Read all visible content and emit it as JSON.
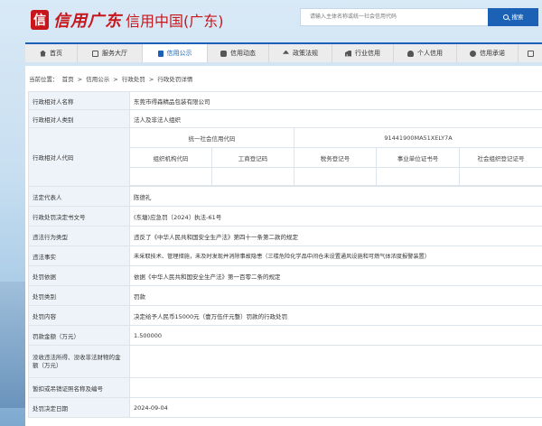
{
  "header": {
    "logo_char": "信",
    "logo_calligraphy": "信用广东",
    "logo_text": "信用中国(广东)",
    "search_placeholder": "请输入主体名称或统一社会信用代码",
    "search_button": "搜索"
  },
  "nav": [
    {
      "label": "首页",
      "icon": "house-icon",
      "active": false
    },
    {
      "label": "服务大厅",
      "icon": "grid-icon",
      "active": false
    },
    {
      "label": "信用公示",
      "icon": "document-icon",
      "active": true
    },
    {
      "label": "信用动态",
      "icon": "message-icon",
      "active": false
    },
    {
      "label": "政策法规",
      "icon": "scale-icon",
      "active": false
    },
    {
      "label": "行业信用",
      "icon": "bar-chart-icon",
      "active": false
    },
    {
      "label": "个人信用",
      "icon": "user-icon",
      "active": false
    },
    {
      "label": "信用承诺",
      "icon": "heart-icon",
      "active": false
    },
    {
      "label": "",
      "icon": "share-icon",
      "active": false
    }
  ],
  "breadcrumb": {
    "prefix": "当前位置：",
    "items": [
      "首页",
      "信用公示",
      "行政处罚",
      "行政处罚详情"
    ],
    "separator": ">"
  },
  "record": {
    "name_label": "行政相对人名称",
    "name_value": "东莞市得森精品包装有限公司",
    "type_label": "行政相对人类别",
    "type_value": "法人及非法人组织",
    "code_label": "行政相对人代码",
    "uscc_header": "统一社会信用代码",
    "uscc_value": "91441900MA51XELY7A",
    "code_headers": [
      "组织机构代码",
      "工商登记码",
      "税务登记号",
      "事业单位证书号",
      "社会组织登记证号"
    ],
    "code_values": [
      "",
      "",
      "",
      "",
      ""
    ],
    "legal_rep_label": "法定代表人",
    "legal_rep_value": "陈德礼",
    "doc_no_label": "行政处罚决定书文号",
    "doc_no_value": "(东塘)应急罚〔2024〕执法-61号",
    "violation_label": "违法行为类型",
    "violation_value": "违反了《中华人民共和国安全生产法》第四十一条第二款的规定",
    "facts_label": "违法事实",
    "facts_value": "未采取技术、管理措施，未及时发现并消除事故隐患（三楼危险化学品中间仓未设置通风设施和可燃气体浓度报警装置）",
    "basis_label": "处罚依据",
    "basis_value": "依据《中华人民共和国安全生产法》第一百零二条的规定",
    "category_label": "处罚类别",
    "category_value": "罚款",
    "content_label": "处罚内容",
    "content_value": "决定给予人民币15000元（壹万伍仟元整）罚款的行政处罚",
    "amount_label": "罚款金额（万元）",
    "amount_value": "1.500000",
    "confiscate_label": "没收违法所得、没收非法财物的金额（万元）",
    "confiscate_value": "",
    "license_label": "暂扣或吊销证照名称及编号",
    "license_value": "",
    "date_label": "处罚决定日期",
    "date_value": "2024-09-04"
  }
}
